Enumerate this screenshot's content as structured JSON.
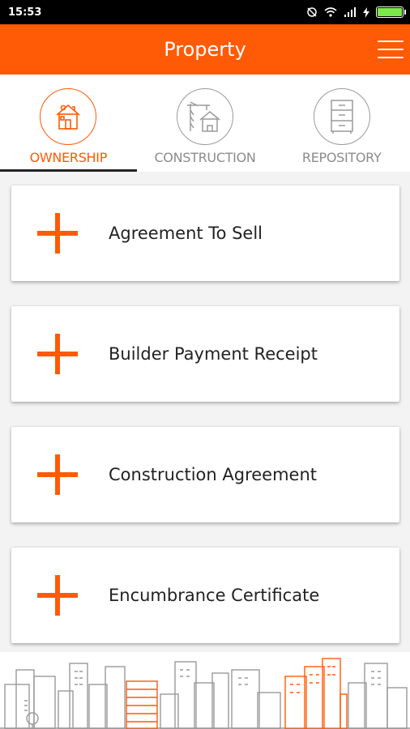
{
  "status_bar": {
    "time": "15:53"
  },
  "app_bar": {
    "title": "Property"
  },
  "tabs": [
    {
      "label": "OWNERSHIP",
      "icon": "house-icon",
      "active": true
    },
    {
      "label": "CONSTRUCTION",
      "icon": "crane-house-icon",
      "active": false
    },
    {
      "label": "REPOSITORY",
      "icon": "cabinet-icon",
      "active": false
    }
  ],
  "items": [
    {
      "label": "Agreement To Sell"
    },
    {
      "label": "Builder Payment Receipt"
    },
    {
      "label": "Construction Agreement"
    },
    {
      "label": "Encumbrance Certificate"
    }
  ],
  "colors": {
    "accent": "#ff5a05",
    "inactive": "#8c8c8c",
    "battery": "#7de84c"
  }
}
